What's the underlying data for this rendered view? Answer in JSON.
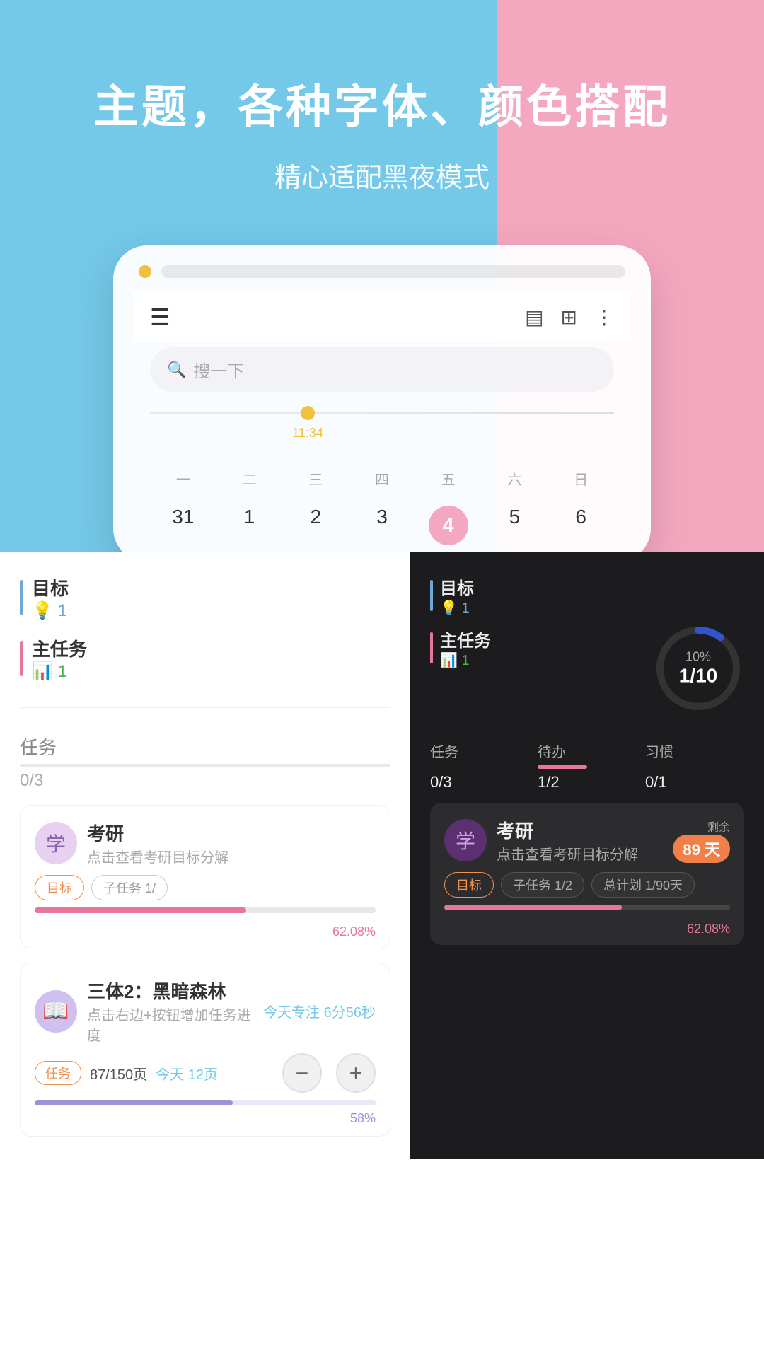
{
  "hero": {
    "title": "主题，各种字体、颜色搭配",
    "subtitle": "精心适配黑夜模式",
    "bg_left": "#74c8e8",
    "bg_right": "#f4a8c0"
  },
  "app": {
    "search_placeholder": "搜一下",
    "timeline_time": "11:34",
    "week_labels": [
      "一",
      "二",
      "三",
      "四",
      "五",
      "六",
      "日"
    ],
    "dates": [
      "31",
      "1",
      "2",
      "3",
      "4",
      "5",
      "6"
    ],
    "today_date": "4"
  },
  "light_stats": {
    "goal_label": "目标",
    "goal_count": "1",
    "main_task_label": "主任务",
    "main_task_count": "1",
    "task_label": "任务",
    "task_count": "0/3"
  },
  "dark_stats": {
    "goal_label": "目标",
    "goal_count": "1",
    "main_task_label": "主任务",
    "main_task_count": "1",
    "progress_percent": "10%",
    "progress_fraction": "1/10",
    "task_label": "任务",
    "task_value": "0/3",
    "todo_label": "待办",
    "todo_value": "1/2",
    "habit_label": "习惯",
    "habit_value": "0/1"
  },
  "goal_card_light": {
    "avatar_text": "学",
    "title": "考研",
    "desc": "点击查看考研目标分解",
    "tag1": "目标",
    "tag2": "子任务 1/",
    "progress_pct": "62.08%",
    "progress_value": 62.08
  },
  "goal_card_dark": {
    "avatar_text": "学",
    "title": "考研",
    "desc": "点击查看考研目标分解",
    "days_label": "剩余",
    "days_value": "89 天",
    "tag1": "目标",
    "tag2": "子任务 1/2",
    "tag3": "总计划 1/90天",
    "progress_pct": "62.08%",
    "progress_value": 62.08
  },
  "book_card": {
    "avatar_text": "📖",
    "title": "三体2：黑暗森林",
    "desc": "点击右边+按钮增加任务进度",
    "focus": "今天专注 6分56秒",
    "tag": "任务",
    "pages": "87/150页",
    "today_pages": "今天 12页",
    "progress_value": 58,
    "progress_pct": "58%",
    "fab_minus": "−",
    "fab_plus": "+"
  }
}
